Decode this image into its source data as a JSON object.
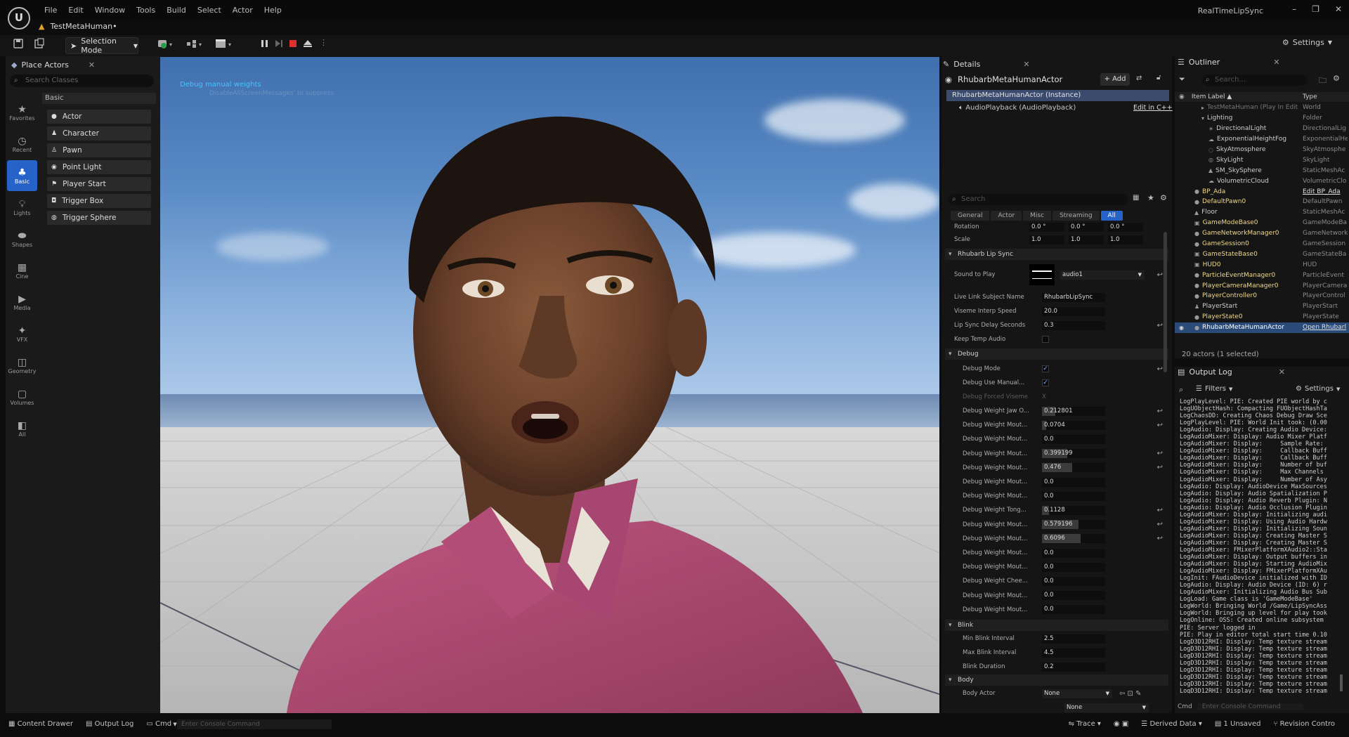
{
  "app": {
    "title": "RealTimeLipSync",
    "level_tab": "TestMetaHuman•",
    "logo": "U"
  },
  "menu": [
    "File",
    "Edit",
    "Window",
    "Tools",
    "Build",
    "Select",
    "Actor",
    "Help"
  ],
  "toolbar": {
    "selection_mode": "Selection Mode",
    "settings": "Settings"
  },
  "place_actors": {
    "tab": "Place Actors",
    "search_placeholder": "Search Classes",
    "categories": [
      "Favorites",
      "Recent",
      "Basic",
      "Lights",
      "Shapes",
      "Cine",
      "Media",
      "VFX",
      "Geometry",
      "Volumes",
      "All"
    ],
    "active_category": "Basic",
    "section": "Basic",
    "items": [
      "Actor",
      "Character",
      "Pawn",
      "Point Light",
      "Player Start",
      "Trigger Box",
      "Trigger Sphere"
    ]
  },
  "viewport": {
    "debug_line1": "Debug manual weights",
    "debug_line2": "DisableAllScreenMessages' to suppress"
  },
  "details": {
    "tab": "Details",
    "actor_name": "RhubarbMetaHumanActor",
    "add_label": "+ Add",
    "instance_row": "RhubarbMetaHumanActor (Instance)",
    "component_row": "AudioPlayback (AudioPlayback)",
    "edit_cpp": "Edit in C++",
    "search_placeholder": "Search",
    "filter_tabs": [
      "General",
      "Actor",
      "Misc",
      "Streaming",
      "All"
    ],
    "active_filter": "All",
    "rotation_label": "Rotation",
    "rotation_values": [
      "0.0 °",
      "0.0 °",
      "0.0 °"
    ],
    "scale_label": "Scale",
    "scale_values": [
      "1.0",
      "1.0",
      "1.0"
    ],
    "section_lipsync": "Rhubarb Lip Sync",
    "sound_to_play_label": "Sound to Play",
    "sound_to_play_value": "audio1",
    "live_link_label": "Live Link Subject Name",
    "live_link_value": "RhubarbLipSync",
    "viseme_label": "Viseme Interp Speed",
    "viseme_value": "20.0",
    "delay_label": "Lip Sync Delay Seconds",
    "delay_value": "0.3",
    "keep_temp_label": "Keep Temp Audio",
    "section_debug": "Debug",
    "debug_mode_label": "Debug Mode",
    "debug_use_manual_label": "Debug Use Manual...",
    "debug_forced_viseme_label": "Debug Forced Viseme",
    "debug_forced_viseme_value": "X",
    "weights": [
      {
        "label": "Debug Weight Jaw O...",
        "value": "0.212801",
        "fraction": 0.212801,
        "reset": true
      },
      {
        "label": "Debug Weight Mout...",
        "value": "0.0704",
        "fraction": 0.0704,
        "reset": true
      },
      {
        "label": "Debug Weight Mout...",
        "value": "0.0",
        "fraction": 0.0,
        "reset": false
      },
      {
        "label": "Debug Weight Mout...",
        "value": "0.399199",
        "fraction": 0.399199,
        "reset": true
      },
      {
        "label": "Debug Weight Mout...",
        "value": "0.476",
        "fraction": 0.476,
        "reset": true
      },
      {
        "label": "Debug Weight Mout...",
        "value": "0.0",
        "fraction": 0.0,
        "reset": false
      },
      {
        "label": "Debug Weight Mout...",
        "value": "0.0",
        "fraction": 0.0,
        "reset": false
      },
      {
        "label": "Debug Weight Tong...",
        "value": "0.1128",
        "fraction": 0.1128,
        "reset": true
      },
      {
        "label": "Debug Weight Mout...",
        "value": "0.579196",
        "fraction": 0.579196,
        "reset": true
      },
      {
        "label": "Debug Weight Mout...",
        "value": "0.6096",
        "fraction": 0.6096,
        "reset": true
      },
      {
        "label": "Debug Weight Mout...",
        "value": "0.0",
        "fraction": 0.0,
        "reset": false
      },
      {
        "label": "Debug Weight Mout...",
        "value": "0.0",
        "fraction": 0.0,
        "reset": false
      },
      {
        "label": "Debug Weight Chee...",
        "value": "0.0",
        "fraction": 0.0,
        "reset": false
      },
      {
        "label": "Debug Weight Mout...",
        "value": "0.0",
        "fraction": 0.0,
        "reset": false
      },
      {
        "label": "Debug Weight Mout...",
        "value": "0.0",
        "fraction": 0.0,
        "reset": false
      }
    ],
    "section_blink": "Blink",
    "min_blink_label": "Min Blink Interval",
    "min_blink_value": "2.5",
    "max_blink_label": "Max Blink Interval",
    "max_blink_value": "4.5",
    "blink_duration_label": "Blink Duration",
    "blink_duration_value": "0.2",
    "section_body": "Body",
    "body_actor_label": "Body Actor",
    "body_actor_value": "None",
    "body_extra_value": "None"
  },
  "outliner": {
    "tab": "Outliner",
    "search_placeholder": "Search...",
    "col_label": "Item Label ▲",
    "col_type": "Type",
    "rows": [
      {
        "name": "TestMetaHuman (Play In Edit",
        "type": "World",
        "color": "dim",
        "ic": "▸"
      },
      {
        "name": "Lighting",
        "type": "Folder",
        "color": "normal",
        "ic": "▾"
      },
      {
        "name": "DirectionalLight",
        "type": "DirectionalLig",
        "color": "normal",
        "ic": "☀"
      },
      {
        "name": "ExponentialHeightFog",
        "type": "ExponentialHe",
        "color": "normal",
        "ic": "☁"
      },
      {
        "name": "SkyAtmosphere",
        "type": "SkyAtmosphe",
        "color": "normal",
        "ic": "◌"
      },
      {
        "name": "SkyLight",
        "type": "SkyLight",
        "color": "normal",
        "ic": "◎"
      },
      {
        "name": "SM_SkySphere",
        "type": "StaticMeshAc",
        "color": "normal",
        "ic": "▲"
      },
      {
        "name": "VolumetricCloud",
        "type": "VolumetricClo",
        "color": "normal",
        "ic": "☁"
      },
      {
        "name": "BP_Ada",
        "type": "Edit BP_Ada",
        "color": "yellow",
        "ic": "●"
      },
      {
        "name": "DefaultPawn0",
        "type": "DefaultPawn",
        "color": "yellow",
        "ic": "●"
      },
      {
        "name": "Floor",
        "type": "StaticMeshAc",
        "color": "normal",
        "ic": "▲"
      },
      {
        "name": "GameModeBase0",
        "type": "GameModeBa",
        "color": "yellow",
        "ic": "▣"
      },
      {
        "name": "GameNetworkManager0",
        "type": "GameNetwork",
        "color": "yellow",
        "ic": "●"
      },
      {
        "name": "GameSession0",
        "type": "GameSession",
        "color": "yellow",
        "ic": "●"
      },
      {
        "name": "GameStateBase0",
        "type": "GameStateBa",
        "color": "yellow",
        "ic": "▣"
      },
      {
        "name": "HUD0",
        "type": "HUD",
        "color": "yellow",
        "ic": "▣"
      },
      {
        "name": "ParticleEventManager0",
        "type": "ParticleEvent",
        "color": "yellow",
        "ic": "●"
      },
      {
        "name": "PlayerCameraManager0",
        "type": "PlayerCamera",
        "color": "yellow",
        "ic": "●"
      },
      {
        "name": "PlayerController0",
        "type": "PlayerControl",
        "color": "yellow",
        "ic": "●"
      },
      {
        "name": "PlayerStart",
        "type": "PlayerStart",
        "color": "normal",
        "ic": "♟"
      },
      {
        "name": "PlayerState0",
        "type": "PlayerState",
        "color": "yellow",
        "ic": "●"
      },
      {
        "name": "RhubarbMetaHumanActor",
        "type": "Open Rhubarl",
        "color": "selected",
        "ic": "●"
      }
    ],
    "count": "20 actors (1 selected)"
  },
  "output_log": {
    "tab": "Output Log",
    "filters": "Filters",
    "settings": "Settings",
    "lines": [
      "LogPlayLevel: PIE: Created PIE world by c",
      "LogUObjectHash: Compacting FUObjectHashTa",
      "LogChaosDD: Creating Chaos Debug Draw Sce",
      "LogPlayLevel: PIE: World Init took: (0.00",
      "LogAudio: Display: Creating Audio Device:",
      "LogAudioMixer: Display: Audio Mixer Platf",
      "LogAudioMixer: Display:     Sample Rate:",
      "LogAudioMixer: Display:     Callback Buff",
      "LogAudioMixer: Display:     Callback Buff",
      "LogAudioMixer: Display:     Number of buf",
      "LogAudioMixer: Display:     Max Channels",
      "LogAudioMixer: Display:     Number of Asy",
      "LogAudio: Display: AudioDevice MaxSources",
      "LogAudio: Display: Audio Spatialization P",
      "LogAudio: Display: Audio Reverb Plugin: N",
      "LogAudio: Display: Audio Occlusion Plugin",
      "LogAudioMixer: Display: Initializing audi",
      "LogAudioMixer: Display: Using Audio Hardw",
      "LogAudioMixer: Display: Initializing Soun",
      "LogAudioMixer: Display: Creating Master S",
      "LogAudioMixer: Display: Creating Master S",
      "LogAudioMixer: FMixerPlatformXAudio2::Sta",
      "LogAudioMixer: Display: Output buffers in",
      "LogAudioMixer: Display: Starting AudioMix",
      "LogAudioMixer: Display: FMixerPlatformXAu",
      "LogInit: FAudioDevice initialized with ID",
      "LogAudio: Display: Audio Device (ID: 6) r",
      "LogAudioMixer: Initializing Audio Bus Sub",
      "LogLoad: Game class is 'GameModeBase'",
      "LogWorld: Bringing World /Game/LipSyncAss",
      "LogWorld: Bringing up level for play took",
      "LogOnline: OSS: Created online subsystem",
      "PIE: Server logged in",
      "PIE: Play in editor total start time 0.10",
      "LogD3D12RHI: Display: Temp texture stream",
      "LogD3D12RHI: Display: Temp texture stream",
      "LogD3D12RHI: Display: Temp texture stream",
      "LogD3D12RHI: Display: Temp texture stream",
      "LogD3D12RHI: Display: Temp texture stream",
      "LogD3D12RHI: Display: Temp texture stream",
      "LogD3D12RHI: Display: Temp texture stream",
      "LogD3D12RHI: Display: Temp texture stream"
    ],
    "cmd": "Cmd",
    "console_placeholder": "Enter Console Command"
  },
  "statusbar": {
    "content_drawer": "Content Drawer",
    "output_log": "Output Log",
    "cmd": "Cmd",
    "console_placeholder": "Enter Console Command",
    "trace": "Trace",
    "derived_data": "Derived Data",
    "unsaved": "1 Unsaved",
    "revision_control": "Revision Contro"
  },
  "colors": {
    "accent": "#2663c9",
    "selection": "#2a4a78",
    "shirt": "#b14a73"
  }
}
